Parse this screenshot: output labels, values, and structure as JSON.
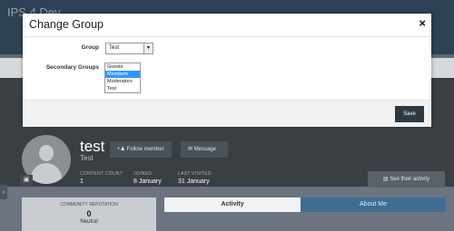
{
  "site": {
    "logo_text": "IPS 4 Dev"
  },
  "profile": {
    "username": "test",
    "group_line": "Test",
    "follow_label": "Follow member",
    "message_label": "Message",
    "stats": [
      {
        "label": "CONTENT COUNT",
        "value": "1"
      },
      {
        "label": "JOINED",
        "value": "8 January"
      },
      {
        "label": "LAST VISITED",
        "value": "31 January"
      }
    ],
    "see_activity_label": "See their activity",
    "reputation": {
      "title": "COMMUNITY REPUTATION",
      "value": "0",
      "label": "Neutral"
    },
    "tabs": {
      "activity": "Activity",
      "about": "About Me"
    }
  },
  "modal": {
    "title": "Change Group",
    "close_glyph": "×",
    "group_label": "Group",
    "group_value": "Test",
    "secondary_label": "Secondary Groups",
    "secondary_options": [
      {
        "label": "Guests",
        "selected": false
      },
      {
        "label": "Members",
        "selected": true
      },
      {
        "label": "Moderators",
        "selected": false
      },
      {
        "label": "Test",
        "selected": false
      }
    ],
    "save_label": "Save"
  },
  "colors": {
    "modal_save": "#2d3a44",
    "selected_option": "#3297fd",
    "about_tab": "#3e6d93"
  }
}
